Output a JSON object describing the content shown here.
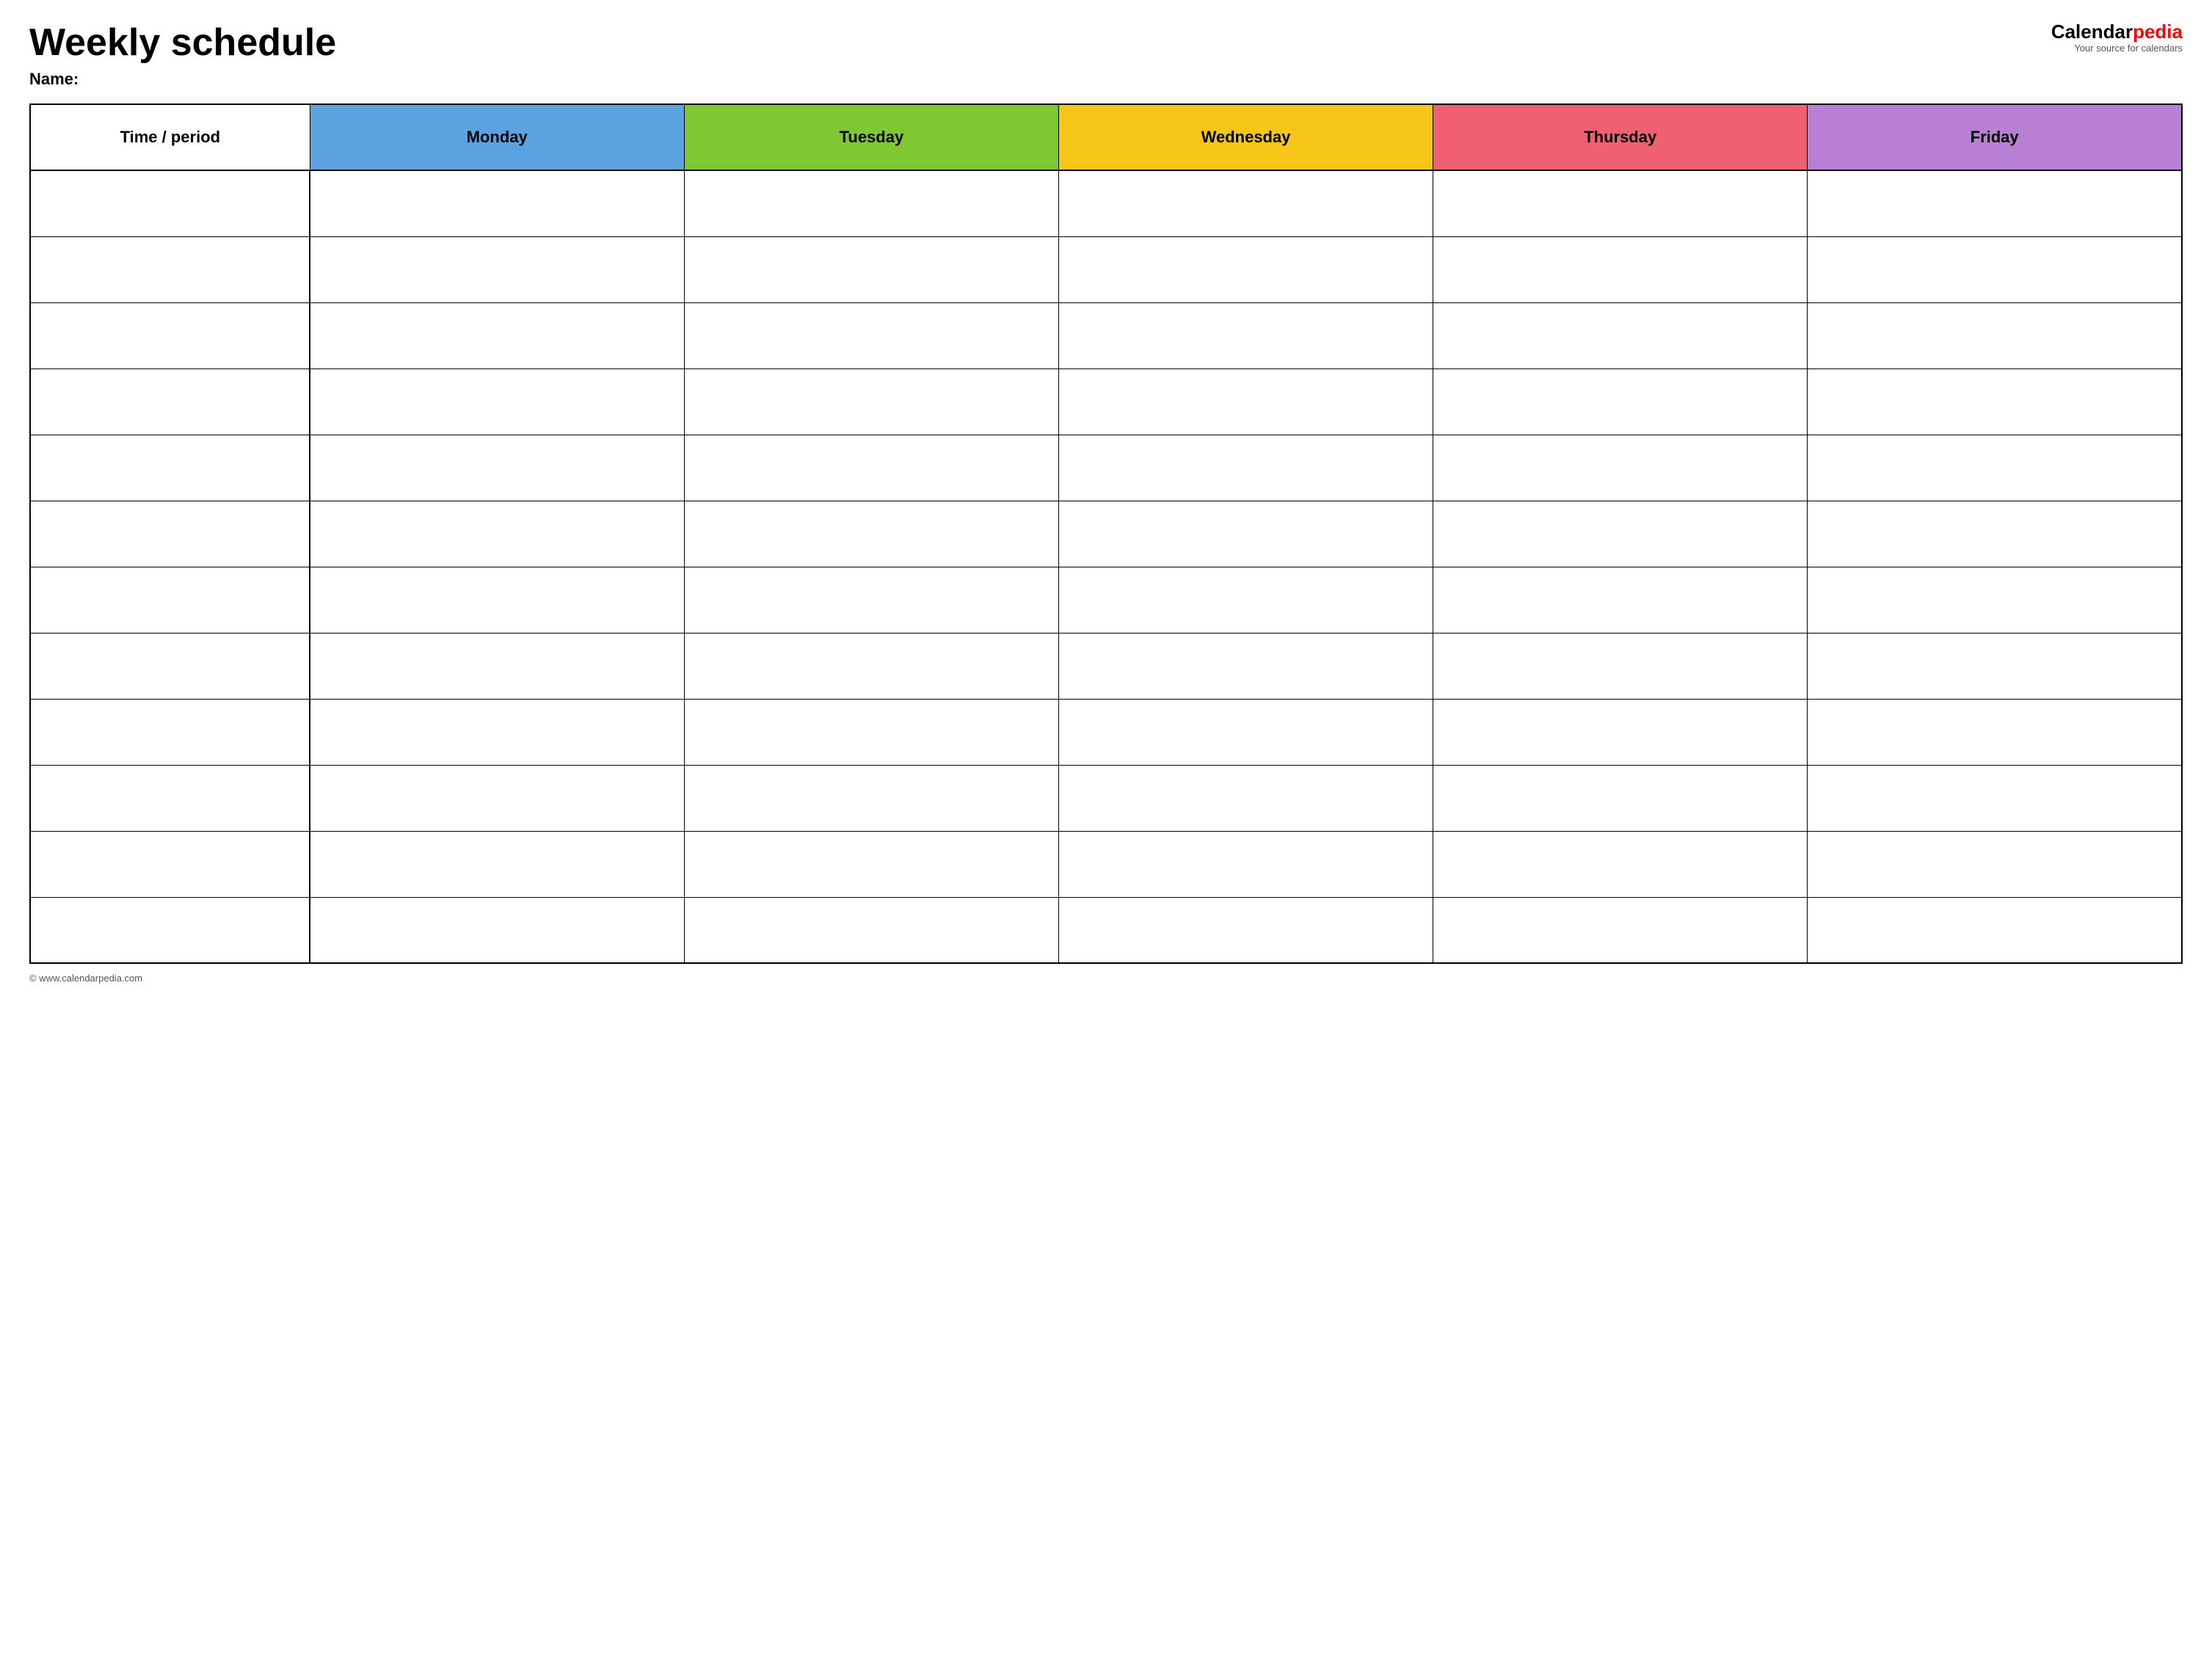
{
  "header": {
    "title": "Weekly schedule",
    "name_label": "Name:",
    "logo_calendar": "Calendar",
    "logo_pedia": "pedia",
    "logo_tagline": "Your source for calendars"
  },
  "table": {
    "columns": [
      {
        "id": "time",
        "label": "Time / period",
        "color": "#ffffff"
      },
      {
        "id": "monday",
        "label": "Monday",
        "color": "#5ba3e0"
      },
      {
        "id": "tuesday",
        "label": "Tuesday",
        "color": "#7ec832"
      },
      {
        "id": "wednesday",
        "label": "Wednesday",
        "color": "#f5c518"
      },
      {
        "id": "thursday",
        "label": "Thursday",
        "color": "#f06070"
      },
      {
        "id": "friday",
        "label": "Friday",
        "color": "#b87fd4"
      }
    ],
    "row_count": 12
  },
  "footer": {
    "url": "© www.calendarpedia.com"
  }
}
